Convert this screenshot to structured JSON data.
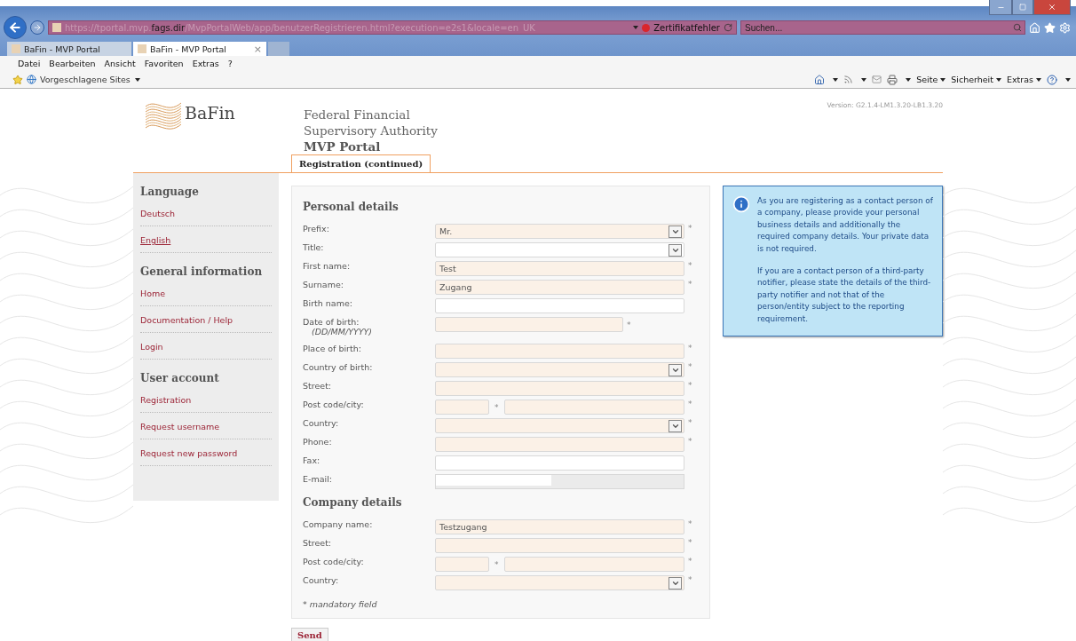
{
  "browser": {
    "address": "https://tportal.mvp.**fags.dir**/MvpPortalWeb/app/benutzerRegistrieren.html?execution=e2s1&locale=en_UK",
    "cert_error": "Zertifikatfehler",
    "search_placeholder": "Suchen...",
    "tabs": [
      {
        "label": "BaFin - MVP Portal",
        "selected": false
      },
      {
        "label": "BaFin - MVP Portal",
        "selected": true,
        "close": "×"
      }
    ],
    "menu": [
      "Datei",
      "Bearbeiten",
      "Ansicht",
      "Favoriten",
      "Extras",
      "?"
    ],
    "favorites_link": "Vorgeschlagene Sites",
    "command_menus": [
      "Seite",
      "Sicherheit",
      "Extras"
    ]
  },
  "header": {
    "logo": "BaFin",
    "org_lines": [
      "Federal Financial",
      "Supervisory Authority"
    ],
    "portal": "MVP Portal",
    "version": "Version: G2.1.4-LM1.3.20-LB1.3.20"
  },
  "page_tabs": [
    {
      "label": "Registration (continued)",
      "selected": true
    }
  ],
  "sidebar": [
    {
      "heading": "Language",
      "items": [
        {
          "label": "Deutsch",
          "selected": false
        },
        {
          "label": "English",
          "selected": true
        }
      ]
    },
    {
      "heading": "General information",
      "items": [
        {
          "label": "Home",
          "selected": false
        },
        {
          "label": "Documentation / Help",
          "selected": false
        },
        {
          "label": "Login",
          "selected": false
        }
      ]
    },
    {
      "heading": "User account",
      "items": [
        {
          "label": "Registration",
          "selected": false
        },
        {
          "label": "Request username",
          "selected": false
        },
        {
          "label": "Request new password",
          "selected": false
        }
      ]
    }
  ],
  "form": {
    "sections": [
      {
        "title": "Personal details",
        "fields": [
          {
            "kind": "select",
            "label": "Prefix:",
            "value": "Mr.",
            "mark": "*"
          },
          {
            "kind": "select",
            "label": "Title:"
          },
          {
            "kind": "text",
            "label": "First name:",
            "value": "Test",
            "mark": "*"
          },
          {
            "kind": "text",
            "label": "Surname:",
            "value": "Zugang",
            "mark": "*"
          },
          {
            "kind": "text",
            "label": "Birth name:"
          },
          {
            "kind": "date",
            "label": "Date of birth:",
            "hint": "(DD/MM/YYYY)",
            "mark": "*"
          },
          {
            "kind": "text",
            "label": "Place of birth:",
            "mark": "*"
          },
          {
            "kind": "select",
            "label": "Country of birth:",
            "mark": "*"
          },
          {
            "kind": "text",
            "label": "Street:",
            "mark": "*"
          },
          {
            "kind": "postcity",
            "label": "Post code/city:",
            "parts": [
              {
                "mark": "*"
              },
              {
                "mark": "*"
              }
            ]
          },
          {
            "kind": "select",
            "label": "Country:",
            "mark": "*"
          },
          {
            "kind": "text",
            "label": "Phone:",
            "mark": "*"
          },
          {
            "kind": "text",
            "label": "Fax:"
          },
          {
            "kind": "email",
            "label": "E-mail:",
            "disabled": true
          }
        ]
      },
      {
        "title": "Company details",
        "fields": [
          {
            "kind": "text",
            "label": "Company name:",
            "value": "Testzugang",
            "mark": "*"
          },
          {
            "kind": "text",
            "label": "Street:",
            "mark": "*"
          },
          {
            "kind": "postcity",
            "label": "Post code/city:",
            "parts": [
              {
                "mark": "*"
              },
              {
                "mark": "*"
              }
            ]
          },
          {
            "kind": "select",
            "label": "Country:",
            "mark": "*"
          }
        ]
      }
    ],
    "footnote": "* mandatory field",
    "submit": "Send"
  },
  "info": {
    "paragraphs": [
      "As you are registering as a contact person of a company, please provide your personal business details and additionally the required company details. Your private data is not required.",
      "If you are a contact person of a third-party notifier, please state the details of the third-party notifier and not that of the person/entity subject to the reporting requirement."
    ]
  }
}
